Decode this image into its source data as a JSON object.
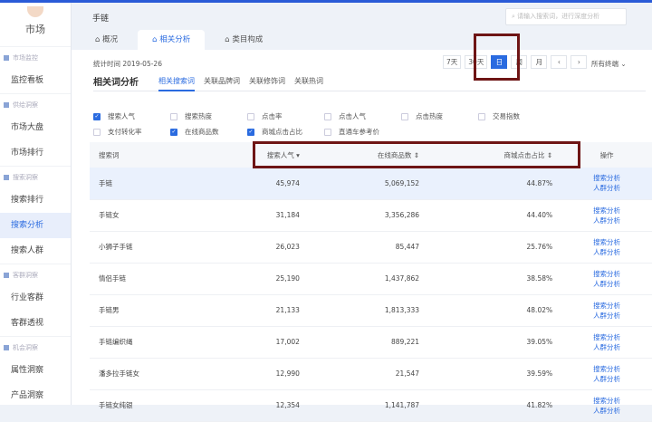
{
  "sidebar": {
    "logo": "市场",
    "groups": [
      {
        "title": "市场监控",
        "items": [
          "监控看板"
        ]
      },
      {
        "title": "供给洞察",
        "items": [
          "市场大盘",
          "市场排行"
        ]
      },
      {
        "title": "搜索洞察",
        "items": [
          "搜索排行",
          "搜索分析",
          "搜索人群"
        ]
      },
      {
        "title": "客群洞察",
        "items": [
          "行业客群",
          "客群透视"
        ]
      },
      {
        "title": "机会洞察",
        "items": [
          "属性洞察",
          "产品洞察"
        ]
      }
    ],
    "active": "搜索分析"
  },
  "header": {
    "title": "手链",
    "search_placeholder": "请输入搜索词，进行深度分析",
    "tabs": [
      "概况",
      "相关分析",
      "类目构成"
    ],
    "active_tab": 1
  },
  "toolbar": {
    "stat_time": "统计时间 2019-05-26",
    "dates": [
      "7天",
      "30天",
      "日",
      "周",
      "月",
      "‹",
      "›"
    ],
    "active_date": 2,
    "terminal": "所有终端"
  },
  "subtabs": {
    "title": "相关词分析",
    "items": [
      "相关搜索词",
      "关联品牌词",
      "关联修饰词",
      "关联热词"
    ],
    "active": 0
  },
  "checks": [
    {
      "label": "搜索人气",
      "on": true
    },
    {
      "label": "搜索热度",
      "on": false
    },
    {
      "label": "点击率",
      "on": false
    },
    {
      "label": "点击人气",
      "on": false
    },
    {
      "label": "点击热度",
      "on": false
    },
    {
      "label": "交易指数",
      "on": false
    },
    {
      "label": "支付转化率",
      "on": false
    },
    {
      "label": "在线商品数",
      "on": true
    },
    {
      "label": "商城点击占比",
      "on": true
    },
    {
      "label": "直通车参考价",
      "on": false
    }
  ],
  "table": {
    "headers": [
      "搜索词",
      "搜索人气 ▾",
      "在线商品数 ⇕",
      "商城点击占比 ⇕",
      "操作"
    ],
    "ops": [
      "搜索分析",
      "人群分析"
    ],
    "rows": [
      [
        "手链",
        "45,974",
        "5,069,152",
        "44.87%"
      ],
      [
        "手链女",
        "31,184",
        "3,356,286",
        "44.40%"
      ],
      [
        "小狮子手链",
        "26,023",
        "85,447",
        "25.76%"
      ],
      [
        "情侣手链",
        "25,190",
        "1,437,862",
        "38.58%"
      ],
      [
        "手链男",
        "21,133",
        "1,813,333",
        "48.02%"
      ],
      [
        "手链编织绳",
        "17,002",
        "889,221",
        "39.05%"
      ],
      [
        "潘多拉手链女",
        "12,990",
        "21,547",
        "39.59%"
      ],
      [
        "手链女纯银",
        "12,354",
        "1,141,787",
        "41.82%"
      ]
    ]
  },
  "colors": {
    "accent": "#2a6be0",
    "highlight": "#6e1515"
  }
}
